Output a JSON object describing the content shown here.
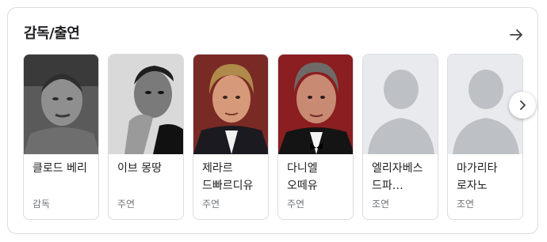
{
  "section": {
    "title": "감독/출연"
  },
  "cast": [
    {
      "name": "클로드 베리",
      "role": "감독"
    },
    {
      "name": "이브 몽땅",
      "role": "주연"
    },
    {
      "name": "제라르 드빠르디유",
      "role": "주연"
    },
    {
      "name": "다니엘 오떼유",
      "role": "주연"
    },
    {
      "name": "엘리자베스 드파…",
      "role": "조연"
    },
    {
      "name": "마가리타 로자노",
      "role": "조연"
    }
  ],
  "icons": {
    "header_link": "arrow-right-icon",
    "next": "chevron-right-icon",
    "placeholder": "person-silhouette-icon"
  },
  "colors": {
    "placeholder_bg": "#e8eaed",
    "placeholder_fg": "#bdc1c6",
    "muted_text": "#70757a"
  }
}
